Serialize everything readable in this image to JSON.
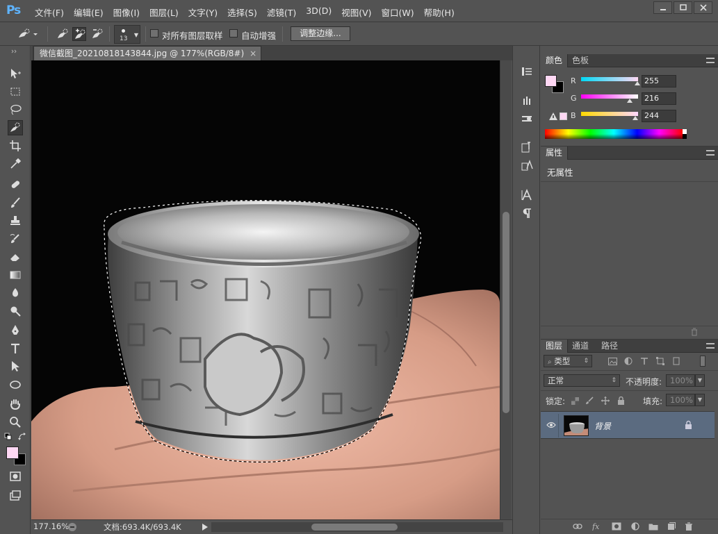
{
  "app": {
    "logo": "Ps"
  },
  "menu": [
    "文件(F)",
    "编辑(E)",
    "图像(I)",
    "图层(L)",
    "文字(Y)",
    "选择(S)",
    "滤镜(T)",
    "3D(D)",
    "视图(V)",
    "窗口(W)",
    "帮助(H)"
  ],
  "options": {
    "brush_size": "13",
    "sample_all_layers": "对所有图层取样",
    "auto_enhance": "自动增强",
    "refine_edge": "调整边缘..."
  },
  "document": {
    "tab_title": "微信截图_20210818143844.jpg @ 177%(RGB/8#)",
    "tab_close": "×",
    "zoom": "177.16%",
    "doc_info": "文档:693.4K/693.4K"
  },
  "colors": {
    "foreground": "#ffd8f4",
    "background": "#000000",
    "accent": "#5fb4ff"
  },
  "color_panel": {
    "tabs": [
      "颜色",
      "色板"
    ],
    "r_label": "R",
    "r_value": "255",
    "g_label": "G",
    "g_value": "216",
    "b_label": "B",
    "b_value": "244"
  },
  "properties_panel": {
    "tab": "属性",
    "empty_text": "无属性"
  },
  "layers_panel": {
    "tabs": [
      "图层",
      "通道",
      "路径"
    ],
    "filter_kind": "类型",
    "blend_mode": "正常",
    "opacity_label": "不透明度:",
    "opacity_value": "100%",
    "lock_label": "锁定:",
    "fill_label": "填充:",
    "fill_value": "100%",
    "layers": [
      {
        "name": "背景"
      }
    ]
  }
}
